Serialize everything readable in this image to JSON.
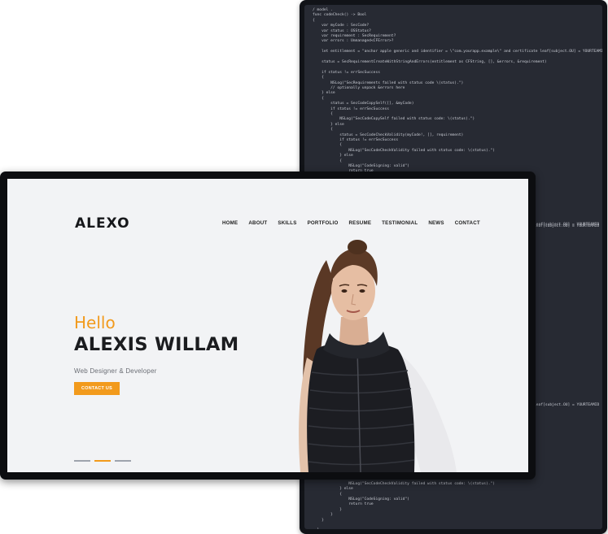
{
  "site": {
    "logo": "ALEXO",
    "nav": [
      "HOME",
      "ABOUT",
      "SKILLS",
      "PORTFOLIO",
      "RESUME",
      "TESTIMONIAL",
      "NEWS",
      "CONTACT"
    ],
    "greeting": "Hello",
    "name": "ALEXIS WILLAM",
    "role": "Web Designer & Developer",
    "cta": "CONTACT US",
    "slider_dots": 3,
    "active_dot": 1,
    "colors": {
      "accent": "#f29a1c",
      "text": "#1b1c1f",
      "background": "#f2f3f5"
    }
  },
  "code": {
    "lines": [
      "/ model .",
      "func codeCheck() -> Bool",
      "{",
      "    var myCode : SecCode?",
      "    var status : OSStatus?",
      "    var requirement : SecRequirement?",
      "    var errors : Unmanaged<CFError>?",
      "",
      "    let entitlement = \"anchor apple generic and identifier = \\\"com.yourapp.example\\\" and certificate leaf[subject.OU] = YOURTEAMID\"",
      "",
      "    status = SecRequirementCreateWithStringAndErrors(entitlement as CFString, [], &errors, &requirement)",
      "",
      "    if status != errSecSuccess",
      "    {",
      "        NSLog(\"SecRequirements failed with status code \\(status).\")",
      "        // optionally unpack &errors here",
      "    } else",
      "    {",
      "        status = SecCodeCopySelf([], &myCode)",
      "        if status != errSecSuccess",
      "        {",
      "            NSLog(\"SecCodeCopySelf failed with status code: \\(status).\")",
      "        } else",
      "        {",
      "            status = SecCodeCheckValidity(myCode!, [], requirement)",
      "            if status != errSecSuccess",
      "            {",
      "                NSLog(\"SecCodeCheckValidity failed with status code: \\(status).\")",
      "            } else",
      "            {",
      "                NSLog(\"CodeSigning: valid\")",
      "                return true",
      "            }",
      "        }",
      "    }",
      "",
      "    }"
    ],
    "side_fragments": [
      "leaf[subject.OU] = YOURTEAMID",
      "leaf[subject.OU] = YOURTEAMID",
      "leaf[subject.OU] = YOURTEAMID"
    ],
    "bottom_lines": [
      "            if status != errSecSuccess",
      "            {",
      "                NSLog(\"SecCodeCheckValidity failed with status code: \\(status).\")",
      "            } else",
      "            {",
      "                NSLog(\"CodeSigning: valid\")",
      "                return true",
      "            }",
      "        }",
      "    }",
      "",
      "  }"
    ]
  }
}
